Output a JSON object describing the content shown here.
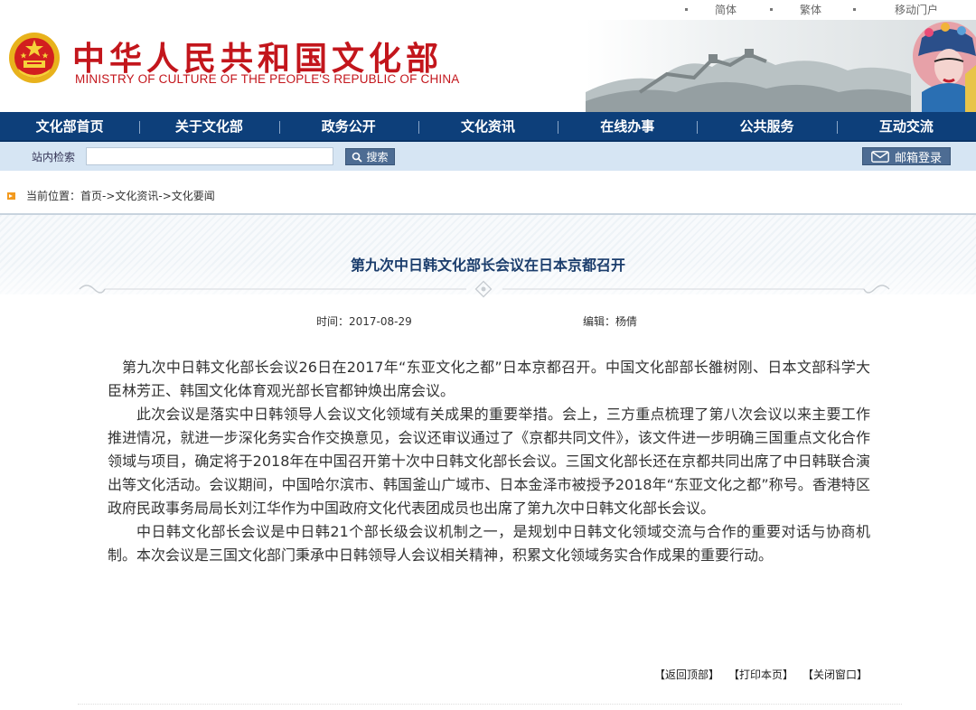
{
  "lang_bar": {
    "simplified": "简体",
    "traditional": "繁体",
    "mobile": "移动门户"
  },
  "header": {
    "title_cn": "中华人民共和国文化部",
    "title_en": "MINISTRY OF CULTURE OF THE PEOPLE'S REPUBLIC OF CHINA",
    "brand_red": "#c3161c"
  },
  "nav": {
    "items": [
      "文化部首页",
      "关于文化部",
      "政务公开",
      "文化资讯",
      "在线办事",
      "公共服务",
      "互动交流"
    ],
    "bg_color": "#0d3f7a"
  },
  "search": {
    "label": "站内检索",
    "value": "",
    "button_label": "搜索",
    "button_icon": "magnifier-icon",
    "mail_label": "邮箱登录",
    "mail_icon": "envelope-icon"
  },
  "breadcrumb": {
    "prefix": "当前位置：",
    "path": "首页->文化资讯->文化要闻"
  },
  "article": {
    "title": "第九次中日韩文化部长会议在日本京都召开",
    "time_label": "时间：",
    "time_value": "2017-08-29",
    "editor_label": "编辑：",
    "editor_value": "杨倩",
    "paragraphs": [
      "第九次中日韩文化部长会议26日在2017年“东亚文化之都”日本京都召开。中国文化部部长雒树刚、日本文部科学大臣林芳正、韩国文化体育观光部长官都钟焕出席会议。",
      "此次会议是落实中日韩领导人会议文化领域有关成果的重要举措。会上，三方重点梳理了第八次会议以来主要工作推进情况，就进一步深化务实合作交换意见，会议还审议通过了《京都共同文件》，该文件进一步明确三国重点文化合作领域与项目，确定将于2018年在中国召开第十次中日韩文化部长会议。三国文化部长还在京都共同出席了中日韩联合演出等文化活动。会议期间，中国哈尔滨市、韩国釜山广域市、日本金泽市被授予2018年“东亚文化之都”称号。香港特区政府民政事务局局长刘江华作为中国政府文化代表团成员也出席了第九次中日韩文化部长会议。",
      "中日韩文化部长会议是中日韩21个部长级会议机制之一，是规划中日韩文化领域交流与合作的重要对话与协商机制。本次会议是三国文化部门秉承中日韩领导人会议相关精神，积累文化领域务实合作成果的重要行动。"
    ],
    "title_color": "#1b3d6c"
  },
  "footer_links": {
    "back_top": "【返回顶部】",
    "print": "【打印本页】",
    "close": "【关闭窗口】"
  }
}
